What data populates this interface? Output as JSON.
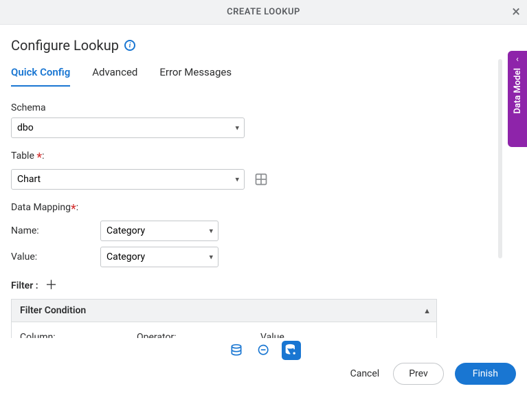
{
  "titlebar": {
    "title": "CREATE LOOKUP"
  },
  "page": {
    "heading": "Configure Lookup"
  },
  "tabs": {
    "quick": "Quick Config",
    "advanced": "Advanced",
    "errors": "Error Messages"
  },
  "schema": {
    "label": "Schema",
    "value": "dbo"
  },
  "table": {
    "label": "Table",
    "value": "Chart"
  },
  "mapping": {
    "label": "Data Mapping",
    "nameLabel": "Name:",
    "nameValue": "Category",
    "valueLabel": "Value:",
    "valueValue": "Category"
  },
  "filter": {
    "label": "Filter :",
    "condition": "Filter Condition",
    "column": "Column:",
    "operator": "Operator:",
    "value": "Value"
  },
  "sidePanel": {
    "label": "Data Model"
  },
  "footer": {
    "cancel": "Cancel",
    "prev": "Prev",
    "finish": "Finish"
  }
}
